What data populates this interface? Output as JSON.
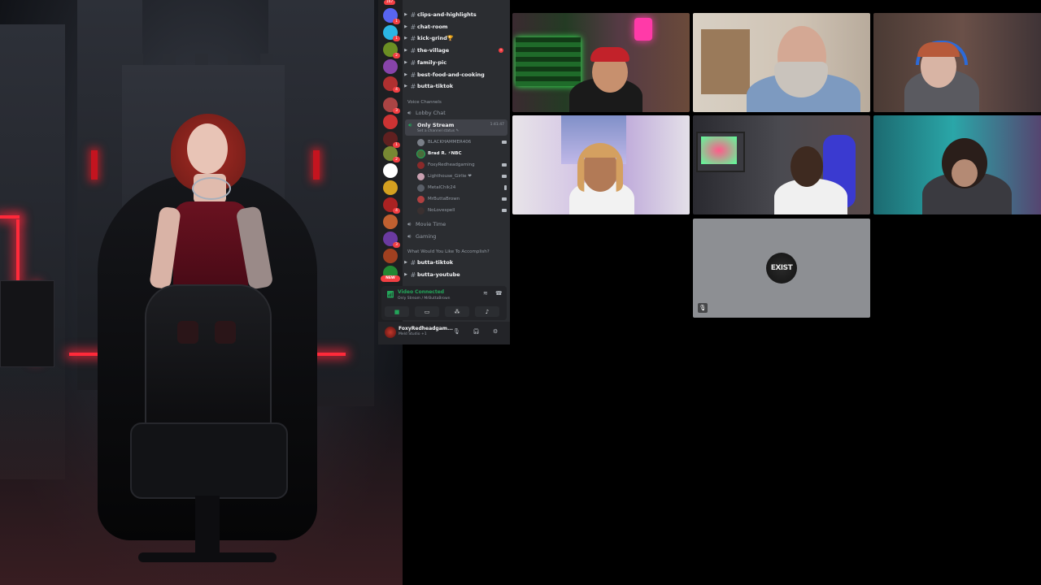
{
  "discord": {
    "server_badges": {
      "top": "167",
      "new_label": "NEW"
    },
    "text_channels": [
      {
        "name": "clips-and-highlights"
      },
      {
        "name": "chat-room"
      },
      {
        "name": "kick-grind🏆"
      },
      {
        "name": "the-village",
        "unread": "•"
      },
      {
        "name": "family-pic"
      },
      {
        "name": "best-food-and-cooking"
      },
      {
        "name": "butta-tiktok"
      }
    ],
    "voice_category": "Voice Channels",
    "voice_channels": {
      "lobby": "Lobby Chat",
      "active": {
        "name": "Only Stream",
        "status": "Set a channel status ✎",
        "timer": "1:41:47"
      },
      "movie": "Movie Time",
      "gaming": "Gaming"
    },
    "members": [
      {
        "name": "BLACKHAMMER406",
        "speaking": false
      },
      {
        "name": "Brad R. ⚡NBC",
        "speaking": true
      },
      {
        "name": "FoxyRedheadgaming",
        "speaking": false
      },
      {
        "name": "Lighthouse_Girlie ❤",
        "speaking": false
      },
      {
        "name": "MetalChik24",
        "speaking": false
      },
      {
        "name": "MrButtaBrown",
        "speaking": false
      },
      {
        "name": "NoLovespell",
        "speaking": false
      }
    ],
    "category2": "What Would You Like To Accomplish?",
    "bottom_channels": [
      {
        "name": "butta-tiktok"
      },
      {
        "name": "butta-youtube"
      }
    ],
    "voice_panel": {
      "status": "Video Connected",
      "location": "Only Stream / MrButtaBrown"
    },
    "user": {
      "name": "FoxyRedheadgam...",
      "status": "Meld Studio +1"
    }
  },
  "video_grid": {
    "empty_tile_logo": "EXIST"
  },
  "colors": {
    "discord_bg": "#2b2d31",
    "rail_bg": "#1e1f22",
    "accent_green": "#23a559",
    "notification_red": "#f23f43",
    "neon_red": "#ff2a3a"
  }
}
